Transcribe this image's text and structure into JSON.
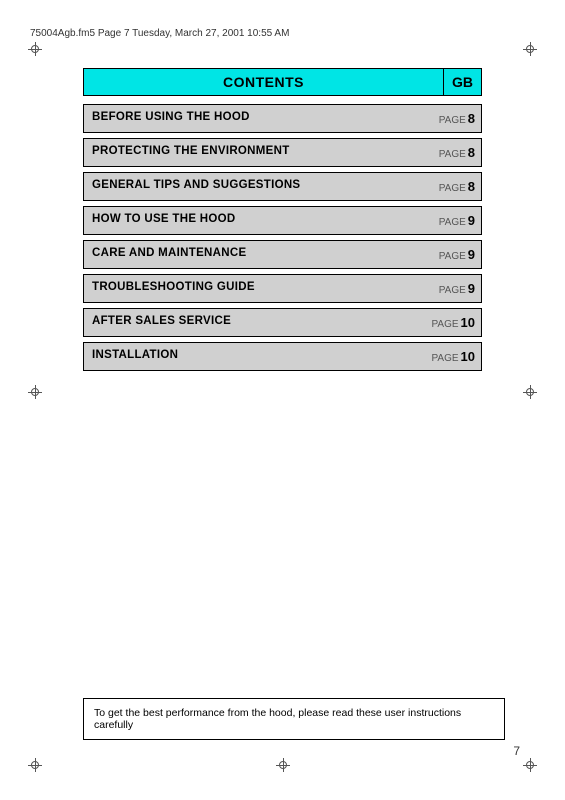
{
  "header": {
    "text": "75004Agb.fm5  Page 7  Tuesday, March 27, 2001  10:55 AM"
  },
  "contents": {
    "title": "CONTENTS",
    "gb_label": "GB",
    "rows": [
      {
        "label": "BEFORE USING THE HOOD",
        "page_word": "PAGE",
        "page_num": "8",
        "style": "normal"
      },
      {
        "label": "PROTECTING THE ENVIRONMENT",
        "page_word": "PAGE",
        "page_num": "8",
        "style": "normal"
      },
      {
        "label": "GENERAL TIPS AND SUGGESTIONS",
        "page_word": "PAGE",
        "page_num": "8",
        "style": "normal"
      },
      {
        "label": "HOW TO USE THE HOOD",
        "page_word": "PAGE",
        "page_num": "9",
        "style": "normal"
      },
      {
        "label": "CARE AND MAINTENANCE",
        "page_word": "PAGE",
        "page_num": "9",
        "style": "normal"
      },
      {
        "label": "TROUBLESHOOTING GUIDE",
        "page_word": "PAGE",
        "page_num": "9",
        "style": "normal"
      },
      {
        "label": "AFTER SALES SERVICE",
        "page_word": "PAGE",
        "page_num": "10",
        "style": "normal"
      },
      {
        "label": "INSTALLATION",
        "page_word": "PAGE",
        "page_num": "10",
        "style": "normal"
      }
    ]
  },
  "bottom_notice": {
    "text": "To get the best performance from the hood, please read these user instructions carefully"
  },
  "page_number": "7"
}
